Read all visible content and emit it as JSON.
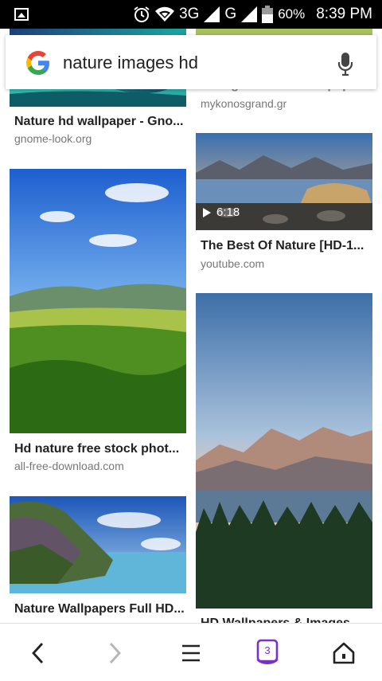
{
  "status_bar": {
    "network_1": "3G",
    "network_2": "G",
    "battery": "60%",
    "time": "8:39 PM"
  },
  "search": {
    "query": "nature images hd"
  },
  "results": [
    {
      "title": "Nature hd wallpaper - Gno...",
      "source": "gnome-look.org"
    },
    {
      "title": "Background-HD-Wallpape",
      "source": "mykonosgrand.gr"
    },
    {
      "title": "The Best Of Nature [HD-1...",
      "source": "youtube.com",
      "duration": "6:18"
    },
    {
      "title": "Hd nature free stock phot...",
      "source": "all-free-download.com"
    },
    {
      "title": "Nature Wallpapers Full HD...",
      "source": ""
    },
    {
      "title": "HD Wallpapers & Images",
      "source": ""
    }
  ],
  "bottom_nav": {
    "tabs_count": "3"
  }
}
